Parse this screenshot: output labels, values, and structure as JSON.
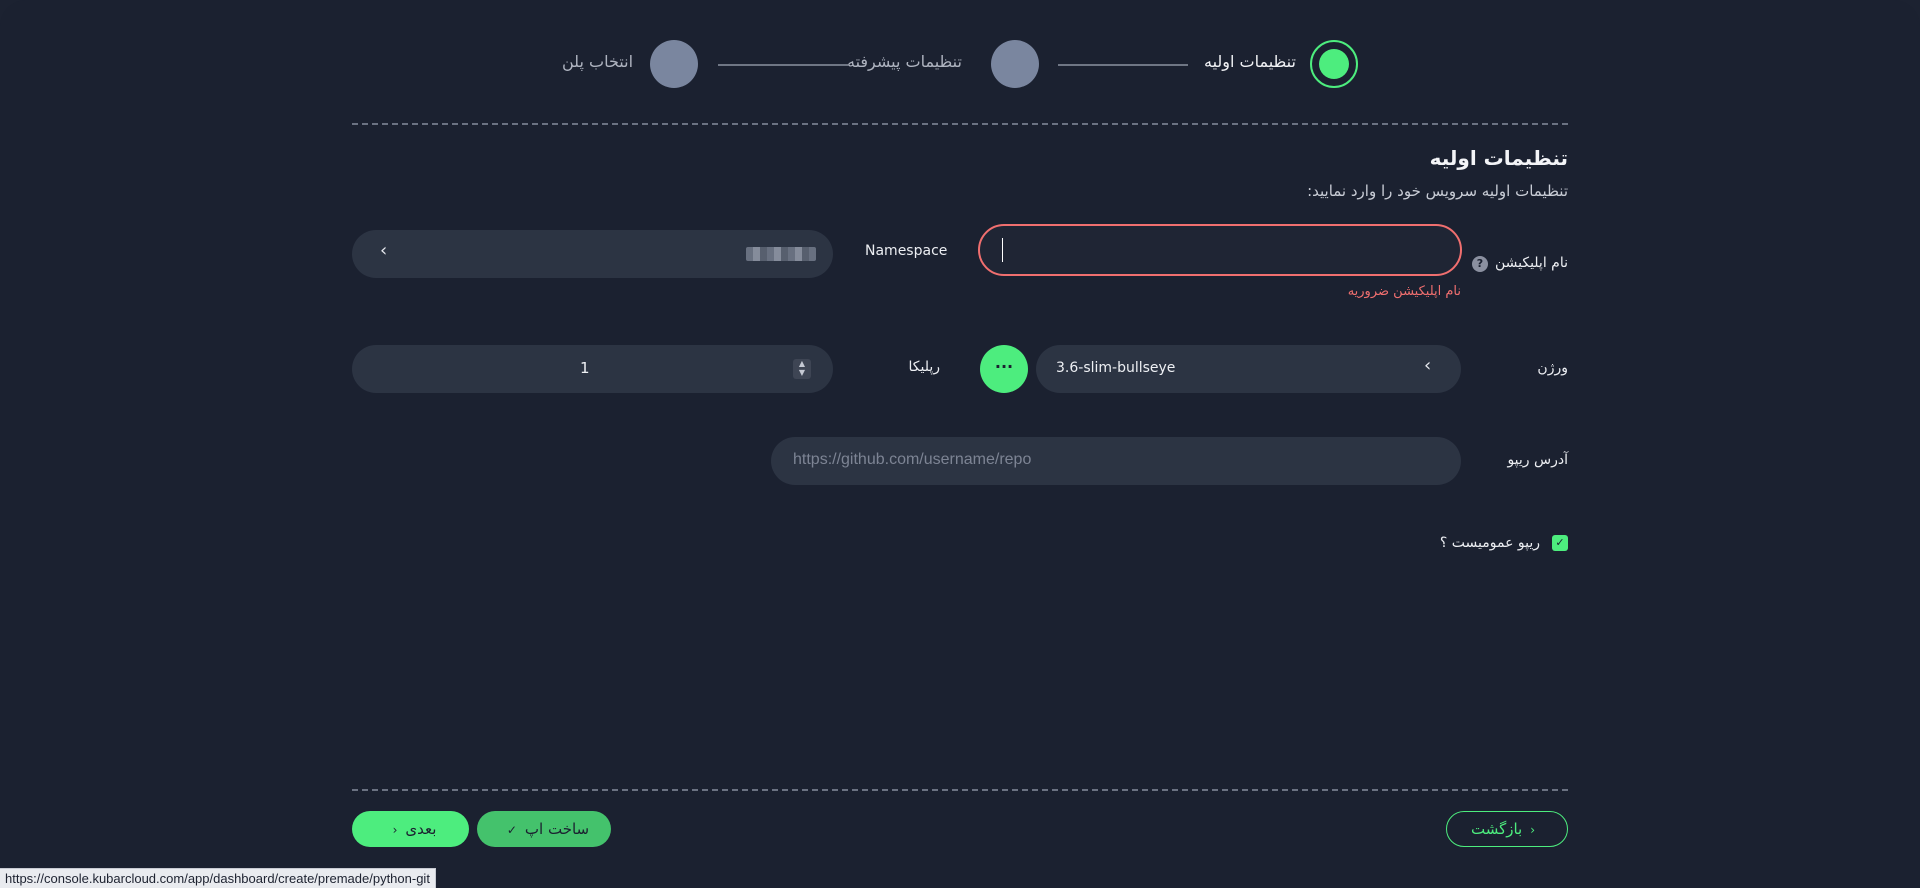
{
  "stepper": {
    "steps": [
      {
        "label": "تنظیمات اولیه",
        "state": "active"
      },
      {
        "label": "تنظیمات پیشرفته",
        "state": "pending"
      },
      {
        "label": "انتخاب پلن",
        "state": "pending"
      }
    ]
  },
  "section": {
    "title": "تنظیمات اولیه",
    "subtitle": "تنظیمات اولیه سرویس خود را وارد نمایید:"
  },
  "form": {
    "app_name": {
      "label": "نام اپلیکیشن",
      "help_icon": "?",
      "value": "",
      "error": "نام اپلیکیشن ضروریه"
    },
    "namespace": {
      "label": "Namespace",
      "value_hidden": true
    },
    "version": {
      "label": "ورژن",
      "value": "3.6-slim-bullseye",
      "more_label": "···"
    },
    "replica": {
      "label": "رپلیکا",
      "value": "1"
    },
    "repo": {
      "label": "آدرس ریپو",
      "placeholder": "https://github.com/username/repo"
    },
    "public_repo": {
      "label": "ریپو عمومیست ؟",
      "checked": true
    }
  },
  "footer": {
    "back_label": "بازگشت",
    "build_label": "ساخت اپ",
    "next_label": "بعدی"
  },
  "statusbar": {
    "url": "https://console.kubarcloud.com/app/dashboard/create/premade/python-git"
  },
  "colors": {
    "accent": "#4ded7e",
    "error": "#f06f6f",
    "background": "#1b2130",
    "field": "#2c3443"
  }
}
